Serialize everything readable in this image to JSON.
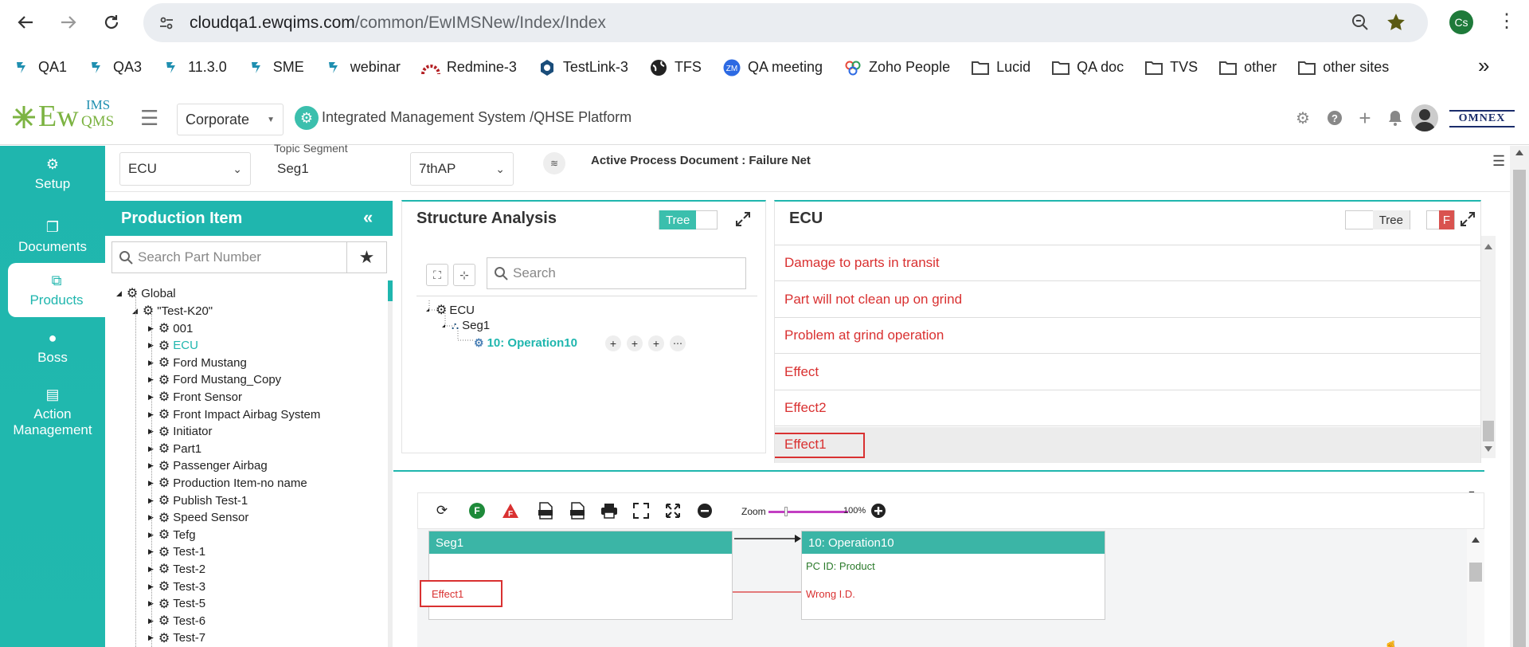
{
  "browser": {
    "url_host": "cloudqa1.ewqims.com",
    "url_path": "/common/EwIMSNew/Index/Index",
    "profile_initials": "Cs",
    "bookmarks": [
      {
        "label": "QA1",
        "icon": "ew-logo-icon"
      },
      {
        "label": "QA3",
        "icon": "ew-logo-icon"
      },
      {
        "label": "11.3.0",
        "icon": "ew-logo-icon"
      },
      {
        "label": "SME",
        "icon": "ew-logo-icon"
      },
      {
        "label": "webinar",
        "icon": "ew-logo-icon"
      },
      {
        "label": "Redmine-3",
        "icon": "redmine-icon"
      },
      {
        "label": "TestLink-3",
        "icon": "testlink-icon"
      },
      {
        "label": "TFS",
        "icon": "globe-icon"
      },
      {
        "label": "QA meeting",
        "icon": "zoom-icon"
      },
      {
        "label": "Zoho People",
        "icon": "zoho-icon"
      },
      {
        "label": "Lucid",
        "icon": "folder-icon"
      },
      {
        "label": "QA doc",
        "icon": "folder-icon"
      },
      {
        "label": "TVS",
        "icon": "folder-icon"
      },
      {
        "label": "other",
        "icon": "folder-icon"
      },
      {
        "label": "other sites",
        "icon": "folder-icon"
      }
    ],
    "more_bookmarks": "»",
    "zoom_icon": "zm"
  },
  "header": {
    "logo_text_left": "Ew",
    "logo_text_top": "IMS",
    "logo_text_bottom": "QMS",
    "org_select": "Corporate",
    "platform": "Integrated Management System /QHSE Platform",
    "brand_right": "OMNEX",
    "accent": "#1fb6ae"
  },
  "leftnav": [
    {
      "label": "Setup",
      "icon": "gears-icon"
    },
    {
      "label": "Documents",
      "icon": "documents-icon"
    },
    {
      "label": "Products",
      "icon": "products-icon"
    },
    {
      "label": "Boss",
      "icon": "boss-icon"
    },
    {
      "label": "Action Management",
      "icon": "building-icon"
    }
  ],
  "filters": {
    "product": "ECU",
    "topic_segment_label": "Topic Segment",
    "topic_segment": "Seg1",
    "process": "7thAP",
    "active_doc": "Active Process Document : Failure Net"
  },
  "production_item": {
    "title": "Production Item",
    "search_placeholder": "Search Part Number",
    "root": "Global",
    "group": "\"Test-K20\"",
    "items": [
      "001",
      "ECU",
      "Ford Mustang",
      "Ford Mustang_Copy",
      "Front Sensor",
      "Front Impact Airbag System",
      "Initiator",
      "Part1",
      "Passenger Airbag",
      "Production Item-no name",
      "Publish Test-1",
      "Speed Sensor",
      "Tefg",
      "Test-1",
      "Test-2",
      "Test-3",
      "Test-5",
      "Test-6",
      "Test-7"
    ],
    "selected": "ECU"
  },
  "structure_analysis": {
    "title": "Structure Analysis",
    "toggle_label": "Tree",
    "search_placeholder": "Search",
    "nodes": {
      "root": "ECU",
      "seg": "Seg1",
      "op": "10: Operation10"
    }
  },
  "ecu_panel": {
    "title": "ECU",
    "toggle_label": "Tree",
    "toggle2_label": "F",
    "rows": [
      "Damage to parts in transit",
      "Part will not clean up on grind",
      "Problem at grind operation",
      "Effect",
      "Effect2",
      "Effect1"
    ],
    "highlighted": "Effect1"
  },
  "diagram": {
    "zoom_label": "Zoom",
    "zoom_value": "100%",
    "seg_box": {
      "title": "Seg1",
      "effect": "Effect1"
    },
    "op_box": {
      "title": "10: Operation10",
      "pc_id": "PC ID: Product",
      "failure": "Wrong I.D."
    }
  }
}
